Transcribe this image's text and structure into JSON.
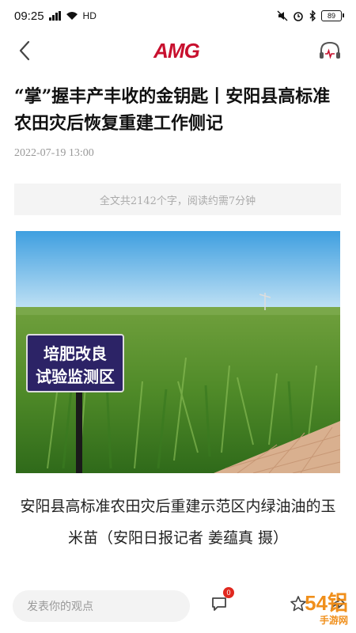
{
  "status_bar": {
    "time": "09:25",
    "network": "HD",
    "battery": "89"
  },
  "nav": {
    "logo": "AMG",
    "back_icon": "chevron-left-icon",
    "listen_icon": "headphones-icon"
  },
  "article": {
    "title": "“掌”握丰产丰收的金钥匙丨安阳县高标准农田灾后恢复重建工作侧记",
    "date": "2022-07-19 13:00",
    "read_info": "全文共2142个字，阅读约需7分钟"
  },
  "photo": {
    "sign_line1": "培肥改良",
    "sign_line2": "试验监测区"
  },
  "caption": "安阳县高标准农田灾后重建示范区内绿油油的玉米苗（安阳日报记者 姜蕴真 摄）",
  "bottom_bar": {
    "comment_placeholder": "发表你的观点",
    "comment_count": "0"
  },
  "watermark": {
    "text": "54铝",
    "sub": "手游网"
  },
  "colors": {
    "brand": "#c8102e",
    "badge": "#e0281f"
  }
}
